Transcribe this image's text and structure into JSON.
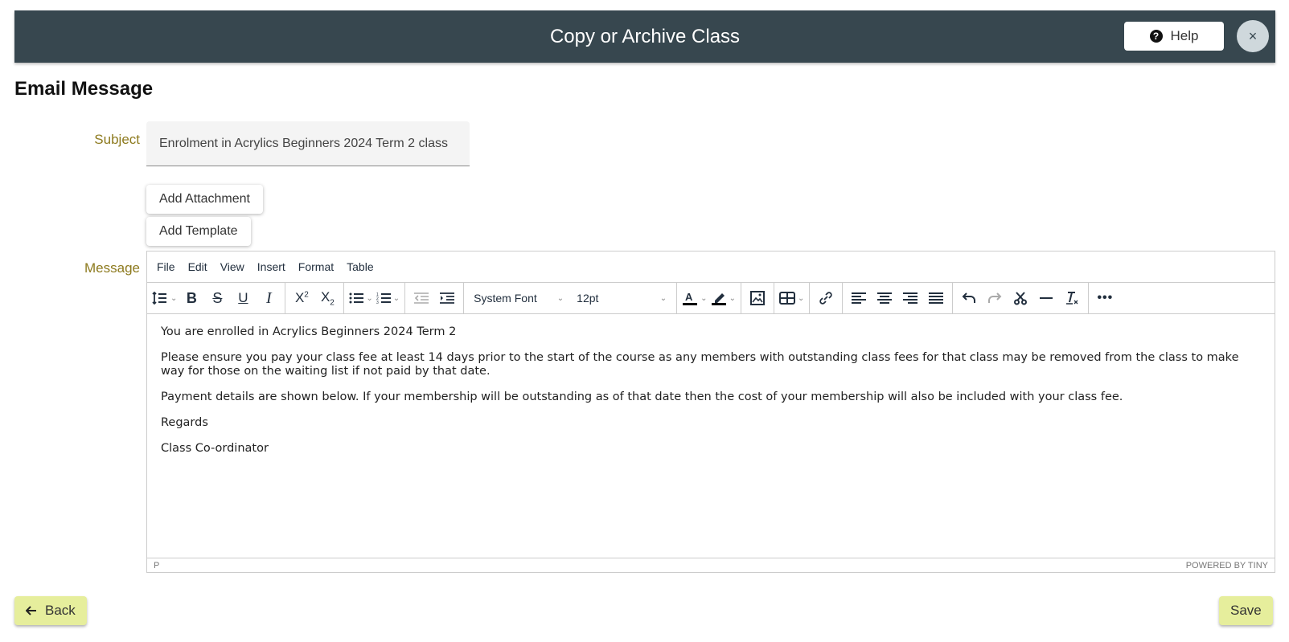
{
  "header": {
    "title": "Copy or Archive Class",
    "help_label": "Help",
    "help_icon": "question-circle-icon",
    "close_icon": "close-icon",
    "close_glyph": "×",
    "background_color": "#37474f"
  },
  "section": {
    "title": "Email Message"
  },
  "subject": {
    "label": "Subject",
    "value": "Enrolment in Acrylics Beginners 2024 Term 2 class"
  },
  "buttons": {
    "add_attachment": "Add Attachment",
    "add_template": "Add Template",
    "back": "Back",
    "save": "Save",
    "action_color": "#e6ee9c"
  },
  "message": {
    "label": "Message",
    "editor": {
      "menu": [
        "File",
        "Edit",
        "View",
        "Insert",
        "Format",
        "Table"
      ],
      "font_family": "System Font",
      "font_size": "12pt",
      "toolbar_icons": [
        "line-height-icon",
        "bold-icon",
        "strikethrough-icon",
        "underline-icon",
        "italic-icon",
        "superscript-icon",
        "subscript-icon",
        "bullet-list-icon",
        "numbered-list-icon",
        "outdent-icon",
        "indent-icon",
        "text-color-icon",
        "highlight-icon",
        "image-icon",
        "table-icon",
        "link-icon",
        "align-left-icon",
        "align-center-icon",
        "align-right-icon",
        "align-justify-icon",
        "undo-icon",
        "redo-icon",
        "cut-icon",
        "horizontal-rule-icon",
        "clear-formatting-icon",
        "more-icon"
      ],
      "paragraphs": [
        "You are enrolled in Acrylics Beginners 2024 Term 2",
        "Please ensure you pay your class fee at least 14 days prior to the start of the course as any members with outstanding class fees for that class may be removed from the class to make way for those on the waiting list if not paid by that date.",
        "Payment details are shown below. If your membership will be outstanding as of that date then the cost of your membership will also be included with your class fee.",
        "Regards",
        "Class Co-ordinator"
      ],
      "status_path": "P",
      "branding": "POWERED BY TINY"
    }
  }
}
